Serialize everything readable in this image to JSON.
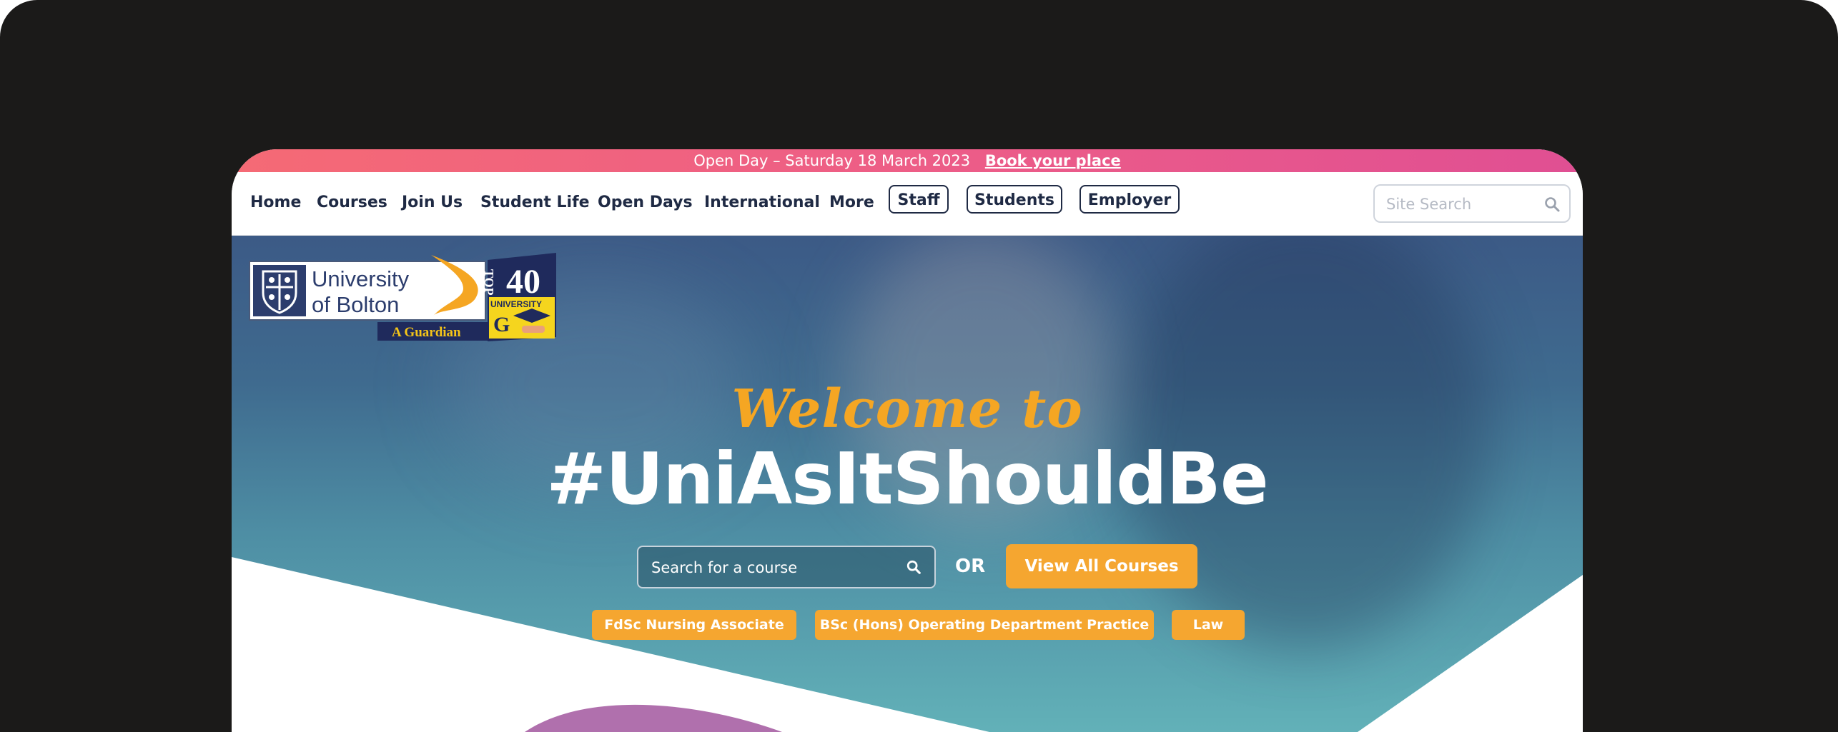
{
  "announcement": {
    "text": "Open Day – Saturday 18 March 2023",
    "link_label": "Book your place"
  },
  "nav": {
    "links": [
      "Home",
      "Courses",
      "Join Us",
      "Student Life",
      "Open Days",
      "International",
      "More"
    ],
    "pills": [
      "Staff",
      "Students",
      "Employer"
    ],
    "search_placeholder": "Site Search"
  },
  "logo": {
    "name_line1": "University",
    "name_line2": "of Bolton",
    "tagline": "A Guardian",
    "badge_top": "TOP",
    "badge_number": "40",
    "badge_label": "UNIVERSITY",
    "badge_letter": "G"
  },
  "hero": {
    "welcome": "Welcome to",
    "headline": "#UniAsItShouldBe",
    "course_search_placeholder": "Search for a course",
    "or_label": "OR",
    "view_all_label": "View All Courses",
    "quick_links": [
      "FdSc Nursing Associate",
      "BSc (Hons) Operating Department Practice",
      "Law"
    ]
  },
  "colors": {
    "accent_orange": "#f5a630",
    "navy": "#1f2a44",
    "announce_pink": "#ec5c88"
  },
  "icons": {
    "site_search": "search-icon",
    "course_search": "search-icon"
  }
}
